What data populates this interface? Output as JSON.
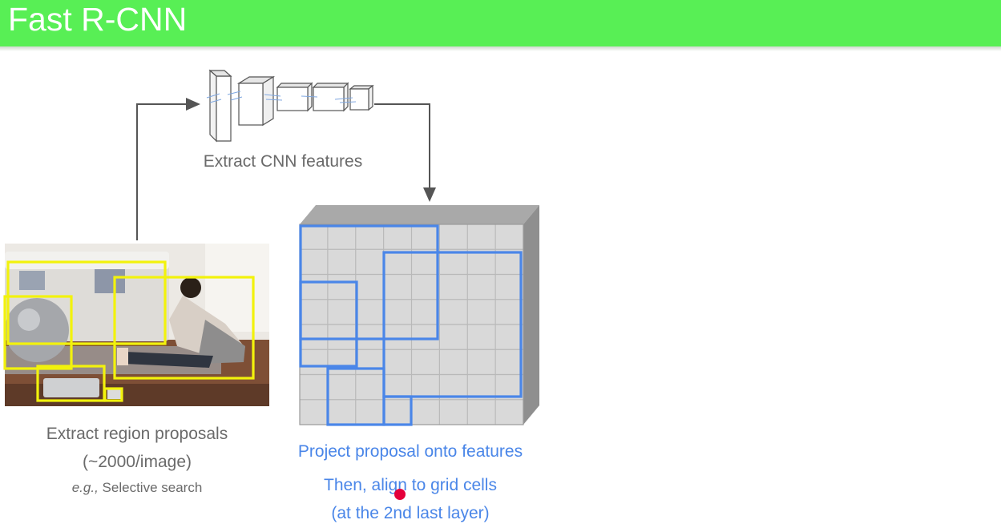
{
  "slide": {
    "title": "Fast R-CNN"
  },
  "labels": {
    "cnn": "Extract CNN features",
    "proposals_line1": "Extract region proposals",
    "proposals_line2": "(~2000/image)",
    "proposals_eg": "e.g.,",
    "proposals_method": "Selective search",
    "project_line1": "Project proposal onto features",
    "project_line2": "Then, align to grid cells",
    "project_line3": "(at the 2nd last layer)"
  },
  "colors": {
    "title_bar": "#58ef55",
    "proposal_box": "#f2f20c",
    "feature_box": "#4a86e8",
    "caption_gray": "#6a6a6a",
    "caption_blue": "#4a86e8",
    "pointer": "#e4003a"
  },
  "feature_grid": {
    "rows": 8,
    "cols": 8
  }
}
